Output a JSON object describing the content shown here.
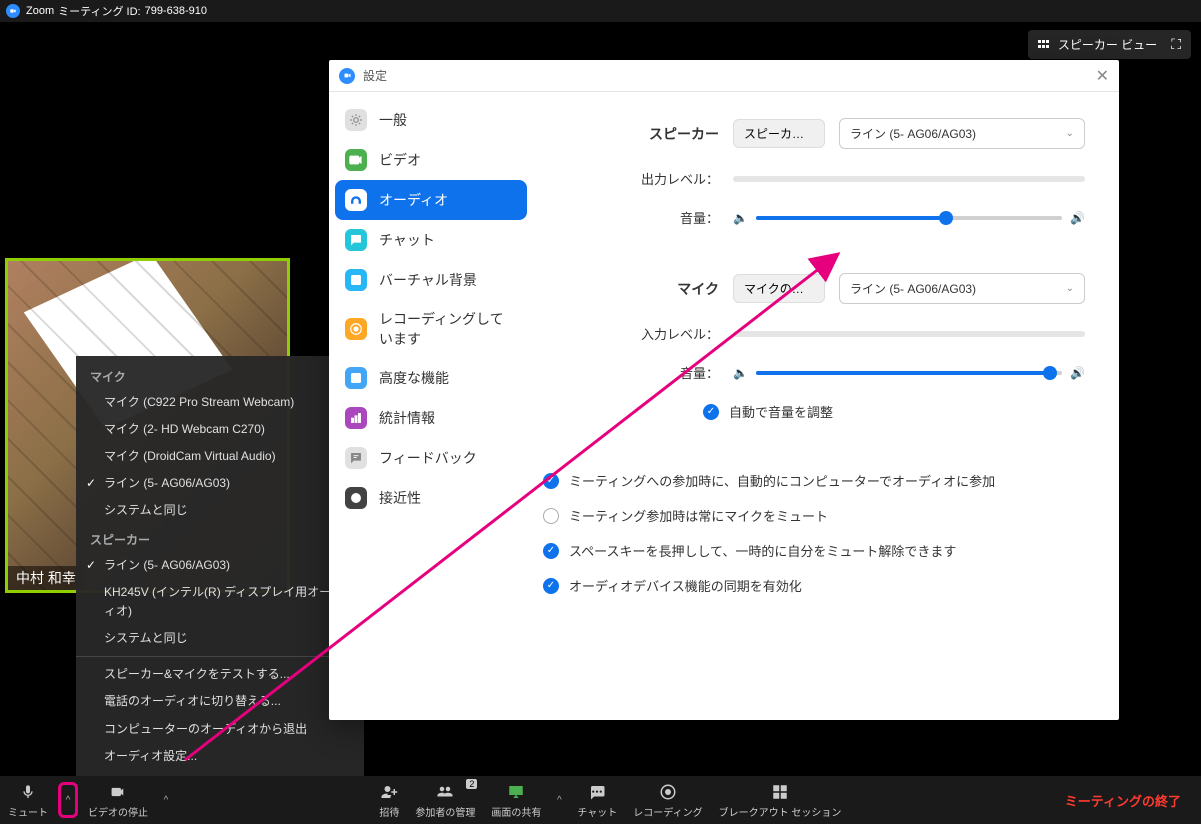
{
  "titlebar": {
    "app": "Zoom",
    "meeting_label": "ミーティング ID:",
    "meeting_id": "799-638-910"
  },
  "speaker_view": {
    "label": "スピーカー ビュー"
  },
  "self_video": {
    "name": "中村 和幸"
  },
  "audio_menu": {
    "mic_header": "マイク",
    "mic_items": [
      {
        "label": "マイク (C922 Pro Stream Webcam)",
        "checked": false
      },
      {
        "label": "マイク (2- HD Webcam C270)",
        "checked": false
      },
      {
        "label": "マイク (DroidCam Virtual Audio)",
        "checked": false
      },
      {
        "label": "ライン (5- AG06/AG03)",
        "checked": true
      },
      {
        "label": "システムと同じ",
        "checked": false
      }
    ],
    "speaker_header": "スピーカー",
    "speaker_items": [
      {
        "label": "ライン (5- AG06/AG03)",
        "checked": true
      },
      {
        "label": "KH245V (インテル(R) ディスプレイ用オーディオ)",
        "checked": false
      },
      {
        "label": "システムと同じ",
        "checked": false
      }
    ],
    "extra": [
      "スピーカー&マイクをテストする...",
      "電話のオーディオに切り替える...",
      "コンピューターのオーディオから退出",
      "オーディオ設定..."
    ]
  },
  "settings": {
    "title": "設定",
    "sidebar": [
      {
        "label": "一般",
        "color": "#e0e0e0",
        "fg": "#888"
      },
      {
        "label": "ビデオ",
        "color": "#4caf50",
        "fg": "#fff"
      },
      {
        "label": "オーディオ",
        "color": "#fff",
        "fg": "#0e72ed",
        "active": true
      },
      {
        "label": "チャット",
        "color": "#26c6da",
        "fg": "#fff"
      },
      {
        "label": "バーチャル背景",
        "color": "#29b6f6",
        "fg": "#fff"
      },
      {
        "label": "レコーディングしています",
        "color": "#ffa726",
        "fg": "#fff"
      },
      {
        "label": "高度な機能",
        "color": "#42a5f5",
        "fg": "#fff"
      },
      {
        "label": "統計情報",
        "color": "#ab47bc",
        "fg": "#fff"
      },
      {
        "label": "フィードバック",
        "color": "#e0e0e0",
        "fg": "#888"
      },
      {
        "label": "接近性",
        "color": "#424242",
        "fg": "#fff"
      }
    ],
    "audio": {
      "speaker_label": "スピーカー",
      "speaker_test": "スピーカーのテ...",
      "speaker_device": "ライン (5- AG06/AG03)",
      "output_level_label": "出力レベル：",
      "volume_label": "音量：",
      "speaker_volume_pct": 62,
      "mic_label": "マイク",
      "mic_test": "マイクのテスト",
      "mic_device": "ライン (5- AG06/AG03)",
      "input_level_label": "入力レベル：",
      "mic_volume_pct": 96,
      "auto_adjust": "自動で音量を調整",
      "opts": [
        {
          "label": "ミーティングへの参加時に、自動的にコンピューターでオーディオに参加",
          "checked": true
        },
        {
          "label": "ミーティング参加時は常にマイクをミュート",
          "checked": false
        },
        {
          "label": "スペースキーを長押しして、一時的に自分をミュート解除できます",
          "checked": true
        },
        {
          "label": "オーディオデバイス機能の同期を有効化",
          "checked": true
        }
      ]
    }
  },
  "toolbar": {
    "mute": "ミュート",
    "stop_video": "ビデオの停止",
    "invite": "招待",
    "participants": "参加者の管理",
    "participants_count": "2",
    "share": "画面の共有",
    "chat": "チャット",
    "record": "レコーディング",
    "breakout": "ブレークアウト セッション",
    "end": "ミーティングの終了"
  }
}
